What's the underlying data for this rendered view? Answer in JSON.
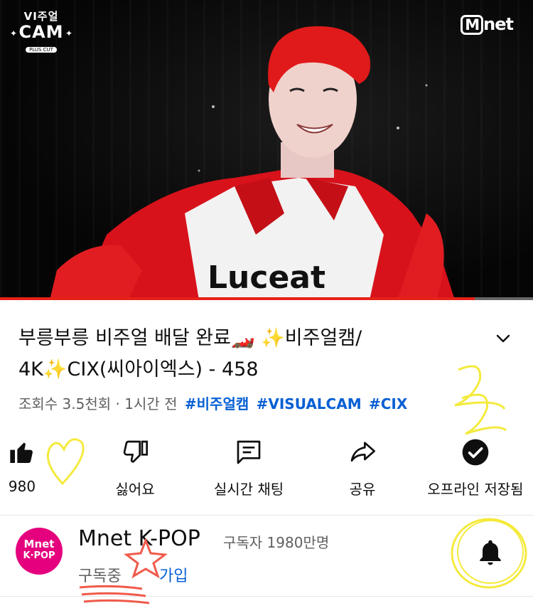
{
  "video": {
    "watermark_top": "VI주얼",
    "watermark_main": "CAM",
    "watermark_bottom": "PLUS CUT",
    "channel_logo_m": "M",
    "channel_logo_rest": "net",
    "jersey_text": "Luceat",
    "progress": 0.89,
    "progress_color": "#e62117"
  },
  "title": {
    "line1": "부릉부릉 비주얼 배달 완료🏎️ ✨비주얼캠/",
    "line2": "4K✨CIX(씨아이엑스) - 458"
  },
  "meta": {
    "views": "조회수 3.5천회 · 1시간 전",
    "tags": [
      "#비주얼캠",
      "#VISUALCAM",
      "#CIX"
    ]
  },
  "actions": [
    {
      "icon": "thumbs-up-icon",
      "label": "980"
    },
    {
      "icon": "thumbs-down-icon",
      "label": "싫어요"
    },
    {
      "icon": "live-chat-icon",
      "label": "실시간 채팅"
    },
    {
      "icon": "share-icon",
      "label": "공유"
    },
    {
      "icon": "downloaded-check-icon",
      "label": "오프라인 저장됨"
    }
  ],
  "channel": {
    "avatar_top": "Mnet",
    "avatar_bottom": "K·POP",
    "avatar_color": "#e5007e",
    "name": "Mnet K-POP",
    "subscribers": "구독자 1980만명",
    "subscribed_label": "구독중",
    "join_label": "가입"
  },
  "colors": {
    "link": "#065fd4",
    "doodle_yellow": "#f4ea3c",
    "doodle_red": "#f05a4a"
  }
}
